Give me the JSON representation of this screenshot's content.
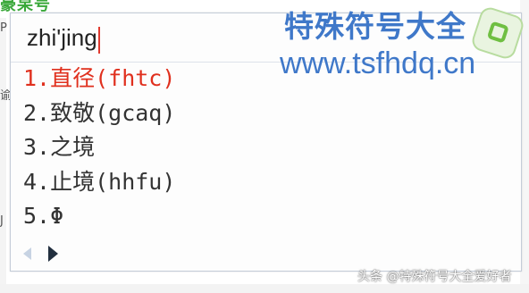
{
  "background": {
    "top_left_text": "豪杲号",
    "left_chars": [
      "P",
      "谕",
      "J"
    ]
  },
  "ime": {
    "input": "zhi'jing",
    "candidates": [
      "1.直径(fhtc)",
      "2.致敬(gcaq)",
      "3.之境",
      "4.止境(hhfu)",
      "5.Φ"
    ],
    "selected_index": 0,
    "nav": {
      "prev_icon": "triangle-left",
      "next_icon": "triangle-right"
    }
  },
  "watermark": {
    "title": "特殊符号大全",
    "url": "www.tsfhdq.cn",
    "logo_icon": "green-rounded-square-logo",
    "credit": "头条 @特殊符号大全爱好者"
  },
  "colors": {
    "selected": "#e0301e",
    "watermark": "#3f78c9",
    "caret": "#e03a2f"
  }
}
